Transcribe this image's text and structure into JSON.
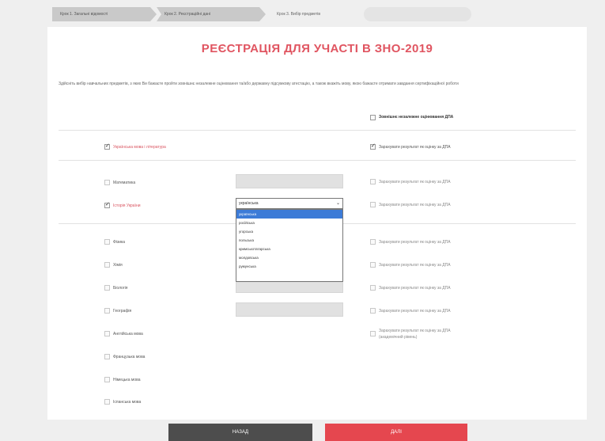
{
  "steps": [
    {
      "label": "Крок 1. Загальні відомості"
    },
    {
      "label": "Крок 2. Реєстраційні дані"
    },
    {
      "label": "Крок 3. Вибір предметів"
    },
    {
      "label": ""
    }
  ],
  "page_title": "РЕЄСТРАЦІЯ ДЛЯ УЧАСТІ В ЗНО-2019",
  "intro_text": "Здійсніть вибір навчальних предметів, з яких Ви бажаєте пройти зовнішнє незалежне оцінювання та/або державну підсумкову атестацію, а також вкажіть мову, якою бажаєте отримати завдання сертифікаційної роботи",
  "dpa_header": {
    "label": "Зовнішнє незалежне оцінювання ДПА",
    "checked": false
  },
  "ukr_subject": {
    "label": "Українська мова і література",
    "checked": true,
    "dpa_label": "Зарахувати результат як оцінку за ДПА",
    "dpa_checked": true
  },
  "subjects": [
    {
      "label": "Математика",
      "checked": false,
      "dpa_label": "Зарахувати результат як оцінку за ДПА"
    },
    {
      "label": "Історія України",
      "checked": true,
      "dpa_label": "Зарахувати результат як оцінку за ДПА"
    },
    {
      "label": "Фізика",
      "checked": false,
      "dpa_label": "Зарахувати результат як оцінку за ДПА"
    },
    {
      "label": "Хімія",
      "checked": false,
      "dpa_label": "Зарахувати результат як оцінку за ДПА"
    },
    {
      "label": "Біологія",
      "checked": false,
      "dpa_label": "Зарахувати результат як оцінку за ДПА"
    },
    {
      "label": "Географія",
      "checked": false,
      "dpa_label": "Зарахувати результат як оцінку за ДПА"
    },
    {
      "label": "Англійська мова",
      "checked": false,
      "dpa_label": "Зарахувати результат як оцінку за ДПА",
      "dpa_note": "(академічний рівень)"
    },
    {
      "label": "Французька мова",
      "checked": false
    },
    {
      "label": "Німецька мова",
      "checked": false
    },
    {
      "label": "Іспанська мова",
      "checked": false
    }
  ],
  "language_select": {
    "value": "українська",
    "options": [
      "українська",
      "російська",
      "угорська",
      "польська",
      "кримськотатарська",
      "молдовська",
      "румунська"
    ],
    "selected_index": 0
  },
  "buttons": {
    "back": "НАЗАД",
    "next": "ДАЛІ"
  },
  "colors": {
    "accent": "#e05561",
    "next_button": "#e5474f",
    "back_button": "#4d4d4d",
    "highlight": "#3c7bd7"
  }
}
